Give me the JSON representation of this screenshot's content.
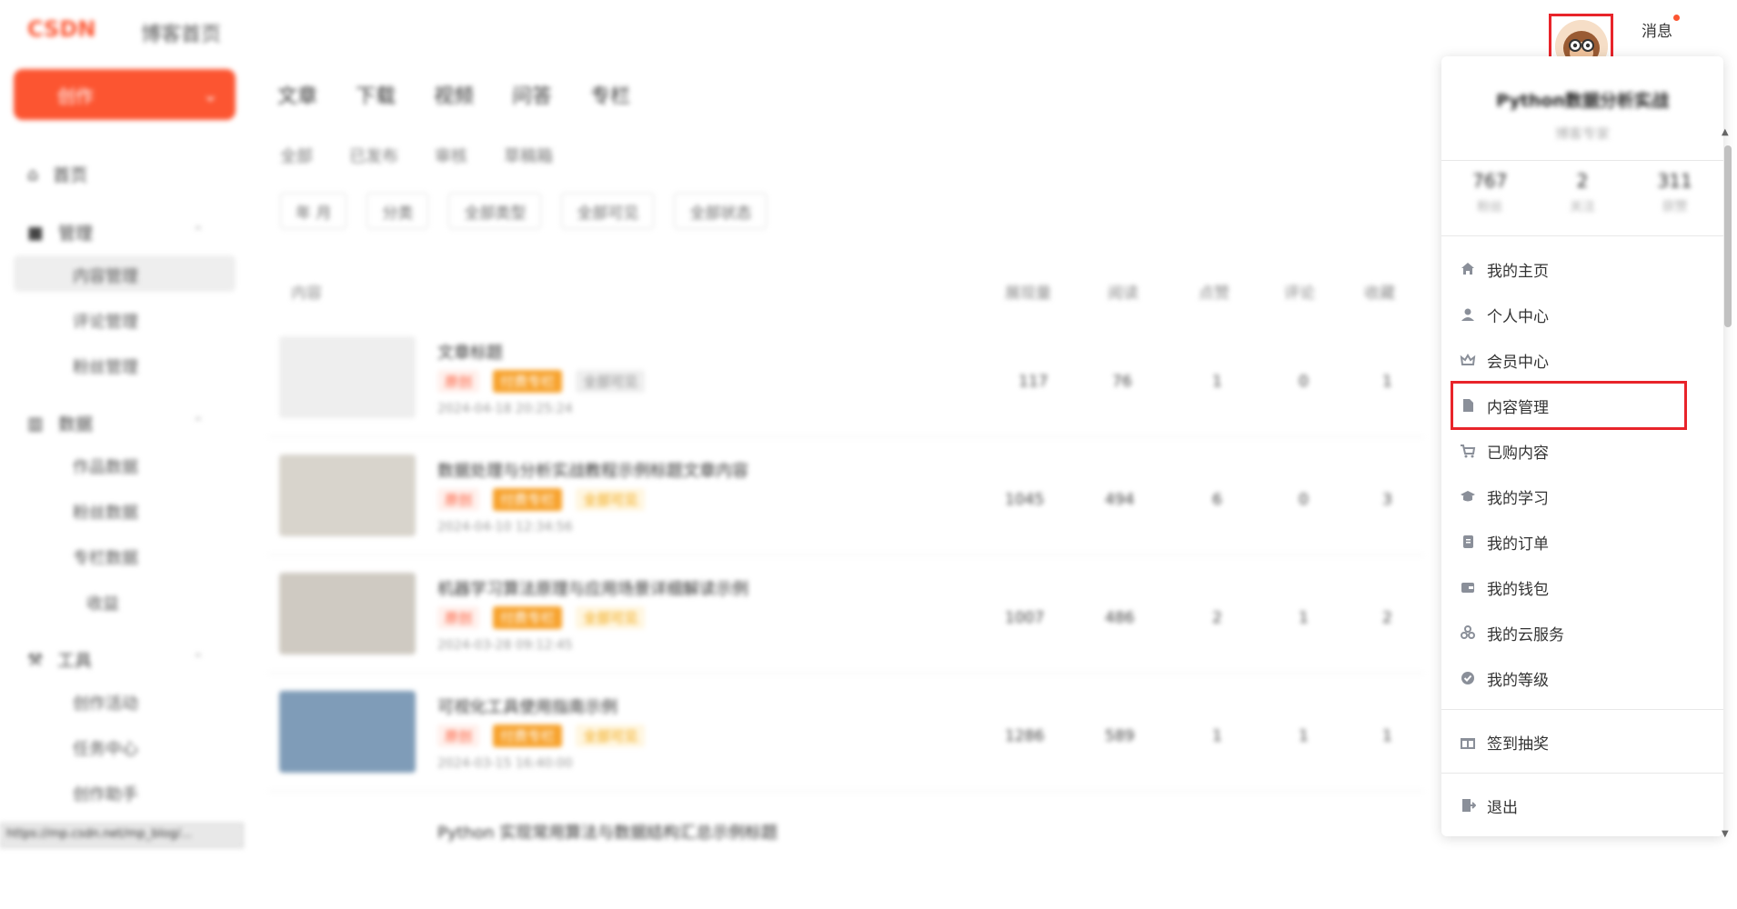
{
  "header": {
    "logo": "CSDN",
    "brand_text": "博客首页",
    "messages_label": "消息"
  },
  "sidebar": {
    "create_label": "创作",
    "groups": [
      {
        "label": "首页"
      },
      {
        "label": "管理",
        "items": [
          "内容管理",
          "评论管理",
          "粉丝管理"
        ]
      },
      {
        "label": "数据",
        "items": [
          "作品数据",
          "粉丝数据",
          "专栏数据",
          "收益"
        ]
      },
      {
        "label": "工具",
        "items": [
          "创作活动",
          "任务中心",
          "创作助手"
        ]
      }
    ],
    "status_url": "https://mp.csdn.net/mp_blog/..."
  },
  "main": {
    "tabs": [
      "文章",
      "下载",
      "视频",
      "问答",
      "专栏"
    ],
    "subtabs": [
      "全部",
      "已发布",
      "审核",
      "草稿箱"
    ],
    "filters": [
      "年 月",
      "分类",
      "全部类型",
      "全部可见",
      "全部状态"
    ],
    "columns": [
      "内容",
      "展现量",
      "阅读",
      "点赞",
      "评论",
      "收藏"
    ],
    "rows": [
      {
        "thumb": "",
        "title": "文章标题",
        "tags": [
          "原创",
          "付费专栏",
          "全部可见"
        ],
        "date": "2024-04-18 20:25:24",
        "stats": [
          "117",
          "76",
          "1",
          "0",
          "1"
        ]
      },
      {
        "thumb": "",
        "title": "数据处理与分析实战教程示例标题文章内容",
        "tags": [
          "原创",
          "付费专栏",
          "全部可见"
        ],
        "date": "2024-04-10 12:34:56",
        "stats": [
          "1045",
          "494",
          "6",
          "0",
          "3"
        ]
      },
      {
        "thumb": "",
        "title": "机器学习算法原理与应用场景详细解读示例",
        "tags": [
          "原创",
          "付费专栏",
          "全部可见"
        ],
        "date": "2024-03-28 09:12:45",
        "stats": [
          "1007",
          "486",
          "2",
          "1",
          "2"
        ]
      },
      {
        "thumb": "",
        "title": "可视化工具使用指南示例",
        "tags": [
          "原创",
          "付费专栏",
          "全部可见"
        ],
        "date": "2024-03-15 16:40:00",
        "stats": [
          "1286",
          "589",
          "1",
          "1",
          "1"
        ]
      },
      {
        "thumb": "",
        "title": "Python 实现常用算法与数据结构汇总示例标题",
        "tags": [],
        "date": "",
        "stats": []
      }
    ]
  },
  "dropdown": {
    "username": "Python数据分析实战",
    "subtitle": "博客专家",
    "stats": [
      {
        "value": "767",
        "label": "粉丝"
      },
      {
        "value": "2",
        "label": "关注"
      },
      {
        "value": "311",
        "label": "获赞"
      }
    ],
    "menu": [
      {
        "label": "我的主页",
        "icon": "home-icon"
      },
      {
        "label": "个人中心",
        "icon": "user-icon"
      },
      {
        "label": "会员中心",
        "icon": "crown-icon"
      },
      {
        "label": "内容管理",
        "icon": "document-icon"
      },
      {
        "label": "已购内容",
        "icon": "cart-icon"
      },
      {
        "label": "我的学习",
        "icon": "graduation-cap-icon"
      },
      {
        "label": "我的订单",
        "icon": "order-icon"
      },
      {
        "label": "我的钱包",
        "icon": "wallet-icon"
      },
      {
        "label": "我的云服务",
        "icon": "cloud-service-icon"
      },
      {
        "label": "我的等级",
        "icon": "level-badge-icon"
      },
      {
        "label": "签到抽奖",
        "icon": "gift-icon"
      },
      {
        "label": "退出",
        "icon": "logout-icon"
      }
    ]
  },
  "colors": {
    "brand": "#fc5531",
    "highlight": "#e8242a",
    "menu_icon": "#8a8f99"
  }
}
